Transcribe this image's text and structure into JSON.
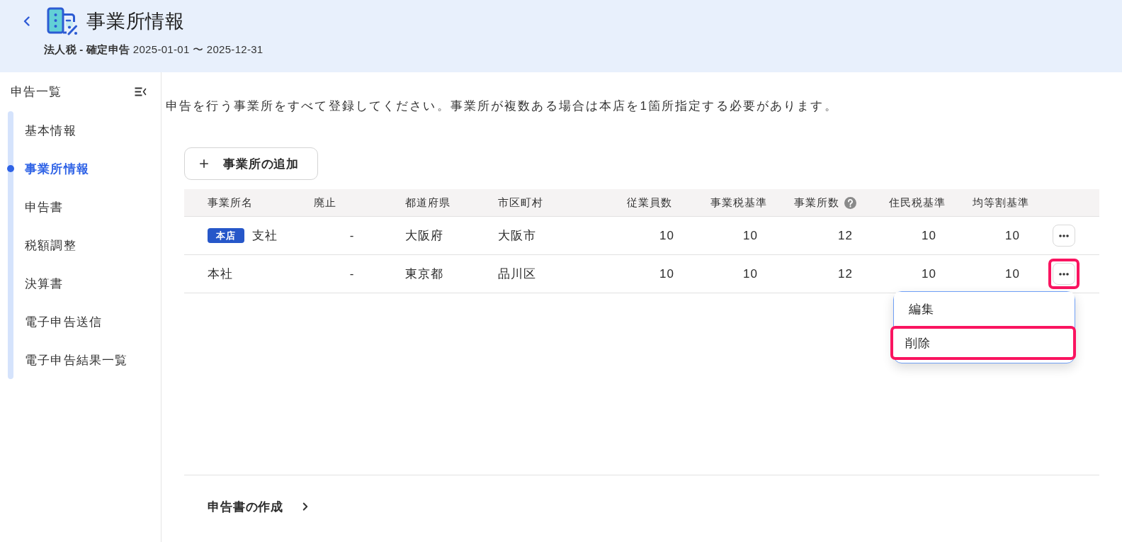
{
  "header": {
    "title": "事業所情報",
    "subtitle": "**法人税 - 確定申告** 2025-01-01 〜 2025-12-31"
  },
  "sidebar": {
    "title": "申告一覧",
    "items": [
      {
        "label": "基本情報",
        "selected": false
      },
      {
        "label": "事業所情報",
        "selected": true
      },
      {
        "label": "申告書",
        "selected": false
      },
      {
        "label": "税額調整",
        "selected": false
      },
      {
        "label": "決算書",
        "selected": false
      },
      {
        "label": "電子申告送信",
        "selected": false
      },
      {
        "label": "電子申告結果一覧",
        "selected": false
      }
    ]
  },
  "main": {
    "description": "申告を行う事業所をすべて登録してください。事業所が複数ある場合は本店を1箇所指定する必要があります。",
    "add_button": "事業所の追加",
    "table": {
      "columns": [
        {
          "label": "事業所名",
          "kind": "name",
          "help": false
        },
        {
          "label": "廃止",
          "kind": "flag",
          "help": false
        },
        {
          "label": "都道府県",
          "kind": "text",
          "help": false
        },
        {
          "label": "市区町村",
          "kind": "text",
          "help": false
        },
        {
          "label": "従業員数",
          "kind": "number",
          "help": false
        },
        {
          "label": "事業税基準",
          "kind": "number",
          "help": false
        },
        {
          "label": "事業所数",
          "kind": "number",
          "help": true
        },
        {
          "label": "住民税基準",
          "kind": "number",
          "help": false
        },
        {
          "label": "均等割基準",
          "kind": "number",
          "help": false
        }
      ],
      "rows": [
        {
          "badge": "本店",
          "cells": [
            "支社",
            "-",
            "大阪府",
            "大阪市",
            "10",
            "10",
            "12",
            "10",
            "10"
          ],
          "menu_open": false,
          "menu_highlighted": false
        },
        {
          "cells": [
            "本社",
            "-",
            "東京都",
            "品川区",
            "10",
            "10",
            "12",
            "10",
            "10"
          ],
          "menu_open": true,
          "menu_highlighted": true
        }
      ],
      "row_menu": {
        "items": [
          {
            "label": "編集",
            "highlighted": false
          },
          {
            "label": "削除",
            "highlighted": true
          }
        ]
      }
    }
  },
  "footer": {
    "next_link": "申告書の作成"
  }
}
